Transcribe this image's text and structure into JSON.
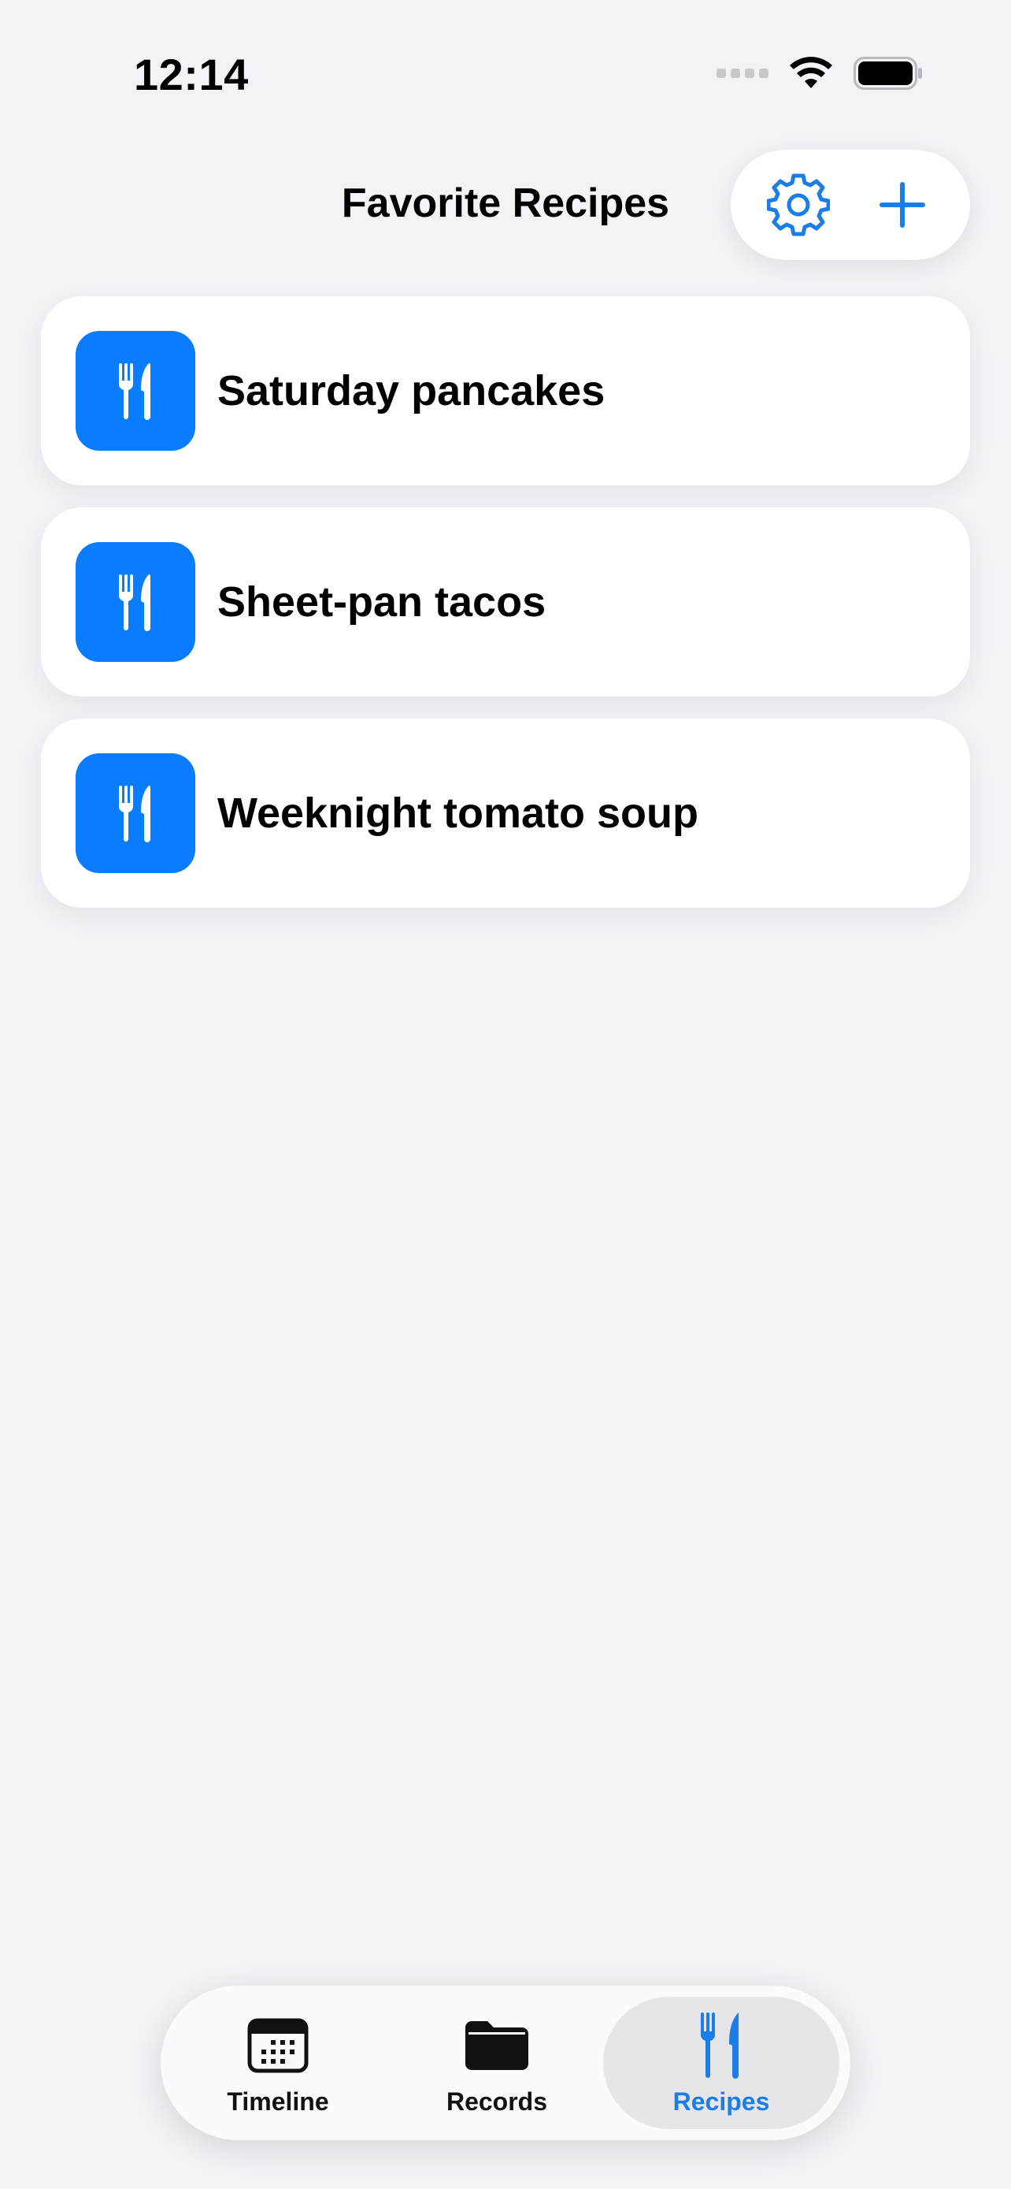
{
  "status_bar": {
    "time": "12:14"
  },
  "header": {
    "title": "Favorite Recipes",
    "settings_icon": "gear-icon",
    "add_icon": "plus-icon"
  },
  "recipes": [
    {
      "name": "Saturday pancakes",
      "icon": "fork-knife-icon"
    },
    {
      "name": "Sheet-pan tacos",
      "icon": "fork-knife-icon"
    },
    {
      "name": "Weeknight tomato soup",
      "icon": "fork-knife-icon"
    }
  ],
  "tab_bar": {
    "tabs": [
      {
        "label": "Timeline",
        "icon": "calendar-icon",
        "selected": false
      },
      {
        "label": "Records",
        "icon": "folder-icon",
        "selected": false
      },
      {
        "label": "Recipes",
        "icon": "fork-knife-icon",
        "selected": true
      }
    ]
  },
  "colors": {
    "accent": "#0a7cff",
    "background": "#f2f2f7",
    "card": "#ffffff",
    "selected_tab_bg": "#e5e5ea"
  }
}
